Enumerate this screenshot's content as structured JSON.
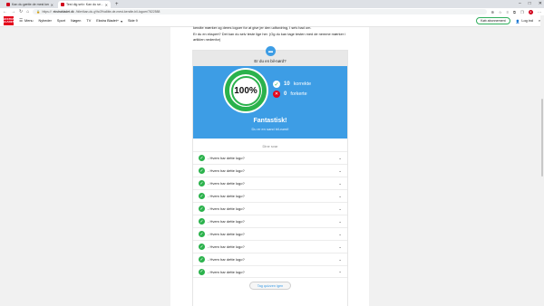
{
  "browser": {
    "tabs": [
      {
        "title": "Kan du gætte de mest kendte bil…",
        "active": false
      },
      {
        "title": "Test dig selv: Kan du se…",
        "active": true
      }
    ],
    "url_prefix": "https://",
    "url_host": "ekstrabladet.dk",
    "url_path": "/biler/kan-du-g%c3%a6tte-de-mest-kendte-bil-logoer/7822588"
  },
  "site": {
    "logo_line1": "EKSTRA",
    "logo_line2": "BLADET",
    "nav": [
      "Menu",
      "Nyheder",
      "Sport",
      "Nøgen",
      "TV",
      "Ekstra Bladet+",
      "Side 9"
    ],
    "subscribe_label": "Køb abonnement",
    "login_label": "Log ind"
  },
  "article": {
    "intro_1": "kendte mærker og deres logoer for at give jer den udfordring, I selv bad om.",
    "intro_2": "Er du en ekspert? Det kan du selv teste lige her. (Og du kan tage testen med de nemme mærker i artiklen nedenfor)"
  },
  "quiz": {
    "header": "Er du en bil-nørd?",
    "percent": "100%",
    "correct_count": "10",
    "correct_label": "korrekte",
    "wrong_count": "0",
    "wrong_label": "forkerte",
    "verdict": "Fantastisk!",
    "verdict_sub": "Du er en sand bil-nørd!",
    "answers_title": "Dine svar",
    "answers": [
      "- Hvem har dette logo?",
      "- Hvem har dette logo?",
      "- Hvem har dette logo?",
      "- Hvem har dette logo?",
      "- Hvem har dette logo?",
      "- Hvem har dette logo?",
      "- Hvem har dette logo?",
      "- Hvem har dette logo?",
      "- Hvem har dette logo?",
      "- Hvem har dette logo?"
    ],
    "retry_label": "Tag quizzen igen"
  },
  "colors": {
    "accent_blue": "#3d9de5",
    "success_green": "#2bb24c",
    "brand_red": "#e3051b"
  }
}
